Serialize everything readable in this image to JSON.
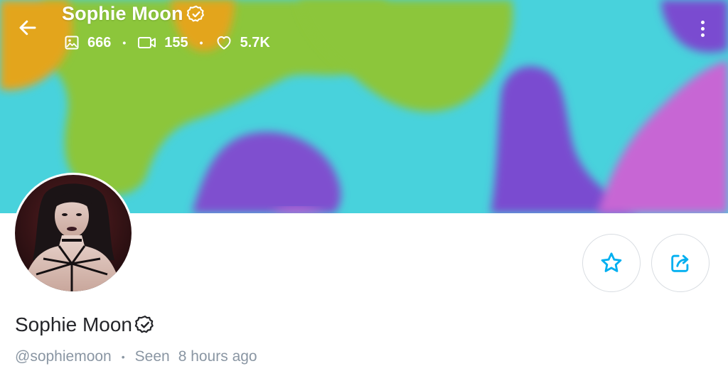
{
  "header": {
    "title": "Sophie Moon",
    "stats": {
      "photos": "666",
      "videos": "155",
      "likes": "5.7K"
    }
  },
  "icons": {
    "back": "arrow-left-icon",
    "verified": "verified-badge-icon",
    "photos": "image-icon",
    "videos": "video-camera-icon",
    "likes": "heart-icon",
    "more": "more-vertical-icon",
    "favorite": "star-icon",
    "share": "share-icon"
  },
  "profile": {
    "name": "Sophie Moon",
    "username": "@sophiemoon",
    "seen_label": "Seen",
    "seen_time": "8 hours ago"
  },
  "colors": {
    "accent": "#00aff0",
    "text_primary": "#242529",
    "text_secondary": "#8a96a3"
  }
}
